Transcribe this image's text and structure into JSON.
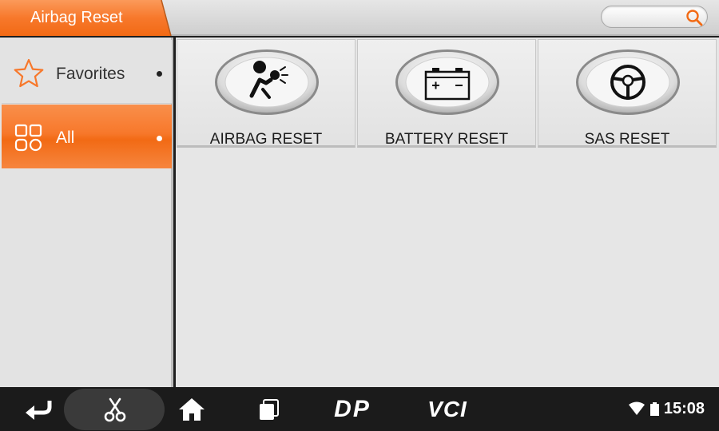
{
  "header": {
    "title": "Airbag Reset",
    "search": {
      "value": "",
      "placeholder": ""
    },
    "accent_color": "#f7782b"
  },
  "sidebar": {
    "items": [
      {
        "label": "Favorites",
        "icon": "star-icon",
        "selected": false
      },
      {
        "label": "All",
        "icon": "grid-icon",
        "selected": true
      }
    ]
  },
  "main": {
    "tiles": [
      {
        "label": "AIRBAG RESET",
        "icon": "airbag-icon"
      },
      {
        "label": "BATTERY RESET",
        "icon": "battery-icon"
      },
      {
        "label": "SAS RESET",
        "icon": "steering-wheel-icon"
      }
    ]
  },
  "navbar": {
    "buttons": [
      "back-icon",
      "scissors-icon",
      "home-icon",
      "recent-apps-icon",
      "dp-icon",
      "vci-icon"
    ],
    "dp_label": "DP",
    "vci_label": "VCI",
    "time": "15:08"
  }
}
